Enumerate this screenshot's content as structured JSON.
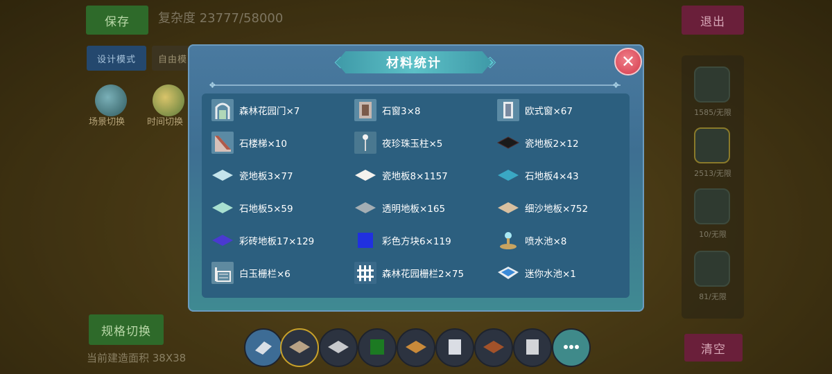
{
  "top_bar": {
    "save_label": "保存",
    "complexity_label": "复杂度 23777/58000",
    "exit_label": "退出"
  },
  "mode_buttons": {
    "design_mode": "设计模式",
    "free_mode": "自由模"
  },
  "scene_icons": {
    "scene_switch": "场景切换",
    "time_switch": "时间切换"
  },
  "right_panel": {
    "counts": [
      "1585/无限",
      "2513/无限",
      "10/无限",
      "81/无限"
    ]
  },
  "bottom": {
    "spec_switch": "规格切换",
    "area_label": "当前建造面积 38X38",
    "clear_label": "清空"
  },
  "modal": {
    "title": "材料统计",
    "items": [
      {
        "label": "森林花园门×7",
        "icon": "garden-gate-icon"
      },
      {
        "label": "石窗3×8",
        "icon": "stone-window-icon"
      },
      {
        "label": "欧式窗×67",
        "icon": "european-window-icon"
      },
      {
        "label": "石楼梯×10",
        "icon": "stone-stairs-icon"
      },
      {
        "label": "夜珍珠玉柱×5",
        "icon": "pearl-pillar-icon"
      },
      {
        "label": "瓷地板2×12",
        "icon": "ceramic-floor-dark-icon"
      },
      {
        "label": "瓷地板3×77",
        "icon": "ceramic-floor-light-icon"
      },
      {
        "label": "瓷地板8×1157",
        "icon": "ceramic-floor-white-icon"
      },
      {
        "label": "石地板4×43",
        "icon": "stone-floor-cyan-icon"
      },
      {
        "label": "石地板5×59",
        "icon": "stone-floor-mint-icon"
      },
      {
        "label": "透明地板×165",
        "icon": "transparent-floor-icon"
      },
      {
        "label": "细沙地板×752",
        "icon": "sand-floor-icon"
      },
      {
        "label": "彩砖地板17×129",
        "icon": "color-tile-floor-icon"
      },
      {
        "label": "彩色方块6×119",
        "icon": "color-cube-icon"
      },
      {
        "label": "喷水池×8",
        "icon": "fountain-icon"
      },
      {
        "label": "白玉栅栏×6",
        "icon": "jade-fence-icon"
      },
      {
        "label": "森林花园栅栏2×75",
        "icon": "garden-fence-icon"
      },
      {
        "label": "迷你水池×1",
        "icon": "mini-pool-icon"
      }
    ]
  },
  "toolbar": {
    "slots": [
      "eraser-icon",
      "sand-tile-icon",
      "white-tile-icon",
      "green-cube-icon",
      "orange-tile-icon",
      "white-cube-icon",
      "brown-tile-icon",
      "gray-cube-icon",
      "more-icon"
    ]
  }
}
